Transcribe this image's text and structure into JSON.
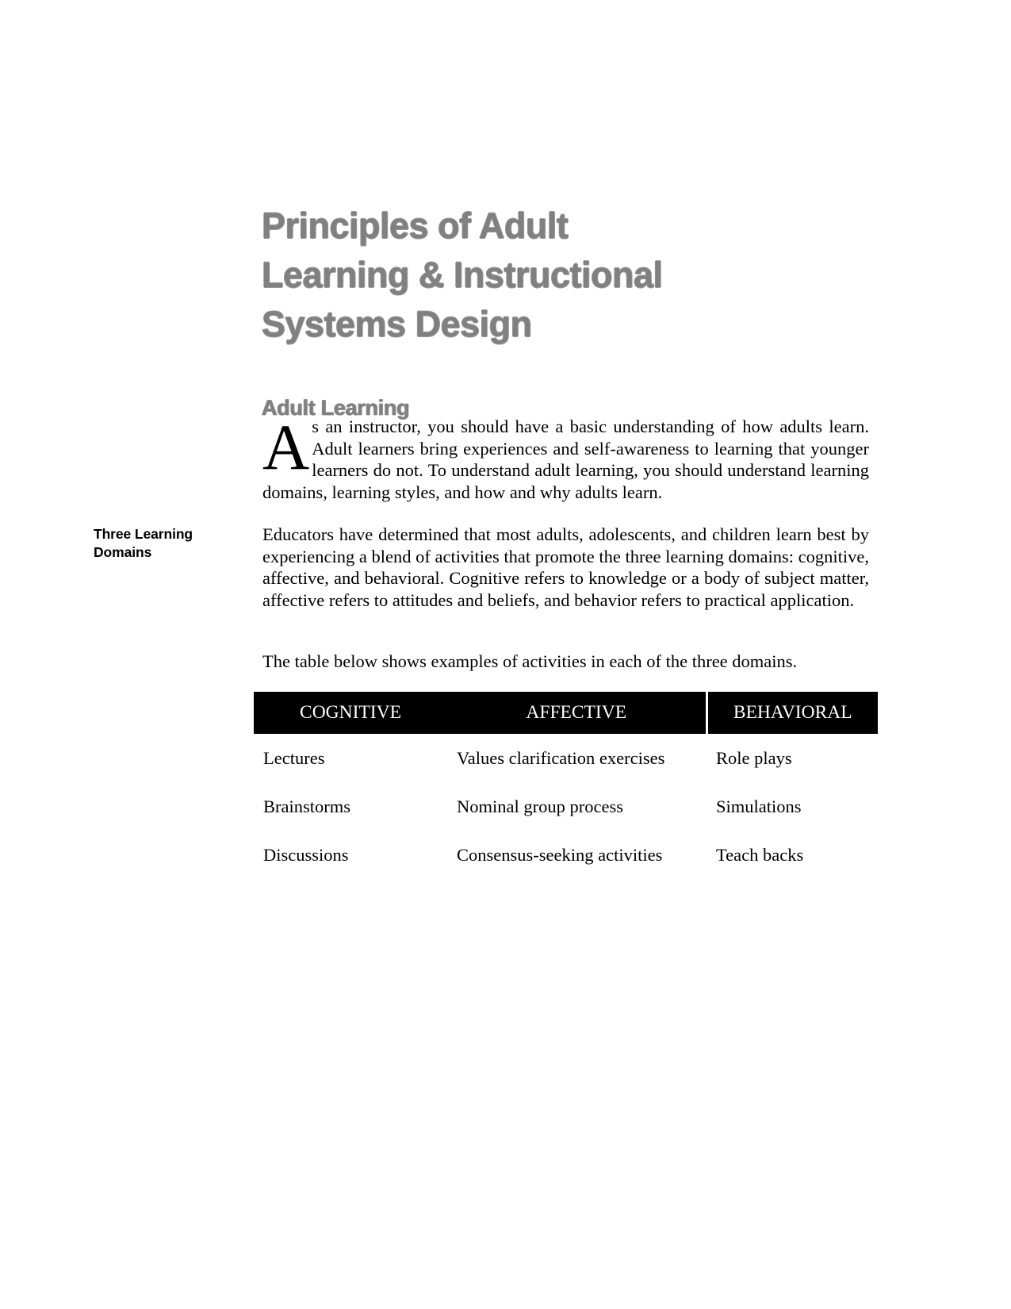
{
  "document": {
    "title_lines": [
      "Principles of Adult",
      "Learning & Instructional",
      "Systems Design"
    ],
    "section_heading": "Adult Learning",
    "paragraphs": {
      "intro_dropcap": "A",
      "intro_text": "s an instructor, you should have a basic understanding of how adults learn. Adult learners bring experiences and self-awareness to learning that younger learners do not.  To understand adult learning, you should understand learning domains, learning styles, and how and why adults learn.",
      "domains_text": "Educators have determined that most adults, adolescents, and children learn best by experiencing a blend of activities that promote the three learning domains: cognitive, affective, and behavioral.  Cognitive refers to knowledge or a body of subject matter, affective refers to attitudes and beliefs, and behavior refers to practical application.",
      "table_intro": "The table below shows examples of activities in each of the three domains."
    },
    "margin_label": {
      "line1": "Three Learning",
      "line2": "Domains"
    },
    "table": {
      "headers": [
        "COGNITIVE",
        "AFFECTIVE",
        "BEHAVIORAL"
      ],
      "rows": [
        [
          "Lectures",
          "Values clarification exercises",
          "Role plays"
        ],
        [
          "Brainstorms",
          "Nominal group process",
          "Simulations"
        ],
        [
          "Discussions",
          "Consensus-seeking activities",
          "Teach backs"
        ]
      ]
    },
    "colors": {
      "heading_gray": "#808080",
      "table_header_bg": "#000000",
      "table_header_text": "#ffffff",
      "body_text": "#000000",
      "page_bg": "#ffffff"
    }
  }
}
